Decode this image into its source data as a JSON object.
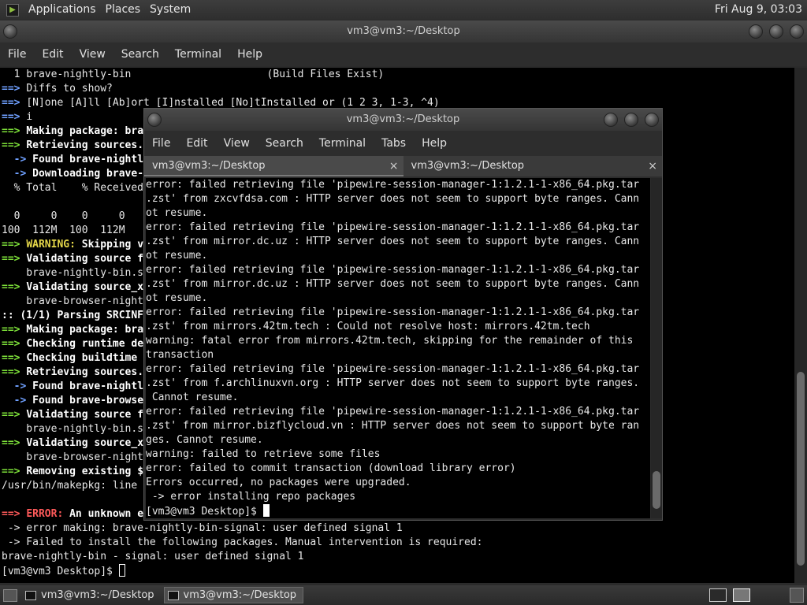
{
  "top_panel": {
    "menus": [
      "Applications",
      "Places",
      "System"
    ],
    "clock": "Fri Aug  9, 03:03"
  },
  "back_window": {
    "title": "vm3@vm3:~/Desktop",
    "menus": [
      "File",
      "Edit",
      "View",
      "Search",
      "Terminal",
      "Help"
    ],
    "lines": [
      [
        {
          "t": "  1 brave-nightly-bin                      (Build Files Exist)"
        }
      ],
      [
        {
          "t": "==> ",
          "c": "blue"
        },
        {
          "t": "Diffs to show?"
        }
      ],
      [
        {
          "t": "==> ",
          "c": "blue"
        },
        {
          "t": "[N]one [A]ll [Ab]ort [I]nstalled [No]tInstalled or (1 2 3, 1-3, ^4)"
        }
      ],
      [
        {
          "t": "==> ",
          "c": "blue"
        },
        {
          "t": "i"
        }
      ],
      [
        {
          "t": "==> ",
          "c": "green"
        },
        {
          "t": "Making package: bra",
          "c": "white"
        }
      ],
      [
        {
          "t": "==> ",
          "c": "green"
        },
        {
          "t": "Retrieving sources.",
          "c": "white"
        }
      ],
      [
        {
          "t": "  -> ",
          "c": "blue"
        },
        {
          "t": "Found brave-nightl",
          "c": "white"
        }
      ],
      [
        {
          "t": "  -> ",
          "c": "blue"
        },
        {
          "t": "Downloading brave-",
          "c": "white"
        }
      ],
      [
        {
          "t": "  % Total    % Received"
        }
      ],
      [
        {
          "t": ""
        }
      ],
      [
        {
          "t": "  0     0    0     0"
        }
      ],
      [
        {
          "t": "100  112M  100  112M"
        }
      ],
      [
        {
          "t": "==> ",
          "c": "green"
        },
        {
          "t": "WARNING: ",
          "c": "yellow"
        },
        {
          "t": "Skipping v",
          "c": "white"
        }
      ],
      [
        {
          "t": "==> ",
          "c": "green"
        },
        {
          "t": "Validating source f",
          "c": "white"
        }
      ],
      [
        {
          "t": "    brave-nightly-bin.s"
        }
      ],
      [
        {
          "t": "==> ",
          "c": "green"
        },
        {
          "t": "Validating source_x",
          "c": "white"
        }
      ],
      [
        {
          "t": "    brave-browser-night"
        }
      ],
      [
        {
          "t": ":: (1/1) Parsing SRCINF",
          "c": "white"
        }
      ],
      [
        {
          "t": "==> ",
          "c": "green"
        },
        {
          "t": "Making package: bra",
          "c": "white"
        }
      ],
      [
        {
          "t": "==> ",
          "c": "green"
        },
        {
          "t": "Checking runtime de",
          "c": "white"
        }
      ],
      [
        {
          "t": "==> ",
          "c": "green"
        },
        {
          "t": "Checking buildtime ",
          "c": "white"
        }
      ],
      [
        {
          "t": "==> ",
          "c": "green"
        },
        {
          "t": "Retrieving sources.",
          "c": "white"
        }
      ],
      [
        {
          "t": "  -> ",
          "c": "blue"
        },
        {
          "t": "Found brave-nightl",
          "c": "white"
        }
      ],
      [
        {
          "t": "  -> ",
          "c": "blue"
        },
        {
          "t": "Found brave-browse",
          "c": "white"
        }
      ],
      [
        {
          "t": "==> ",
          "c": "green"
        },
        {
          "t": "Validating source f",
          "c": "white"
        }
      ],
      [
        {
          "t": "    brave-nightly-bin.s"
        }
      ],
      [
        {
          "t": "==> ",
          "c": "green"
        },
        {
          "t": "Validating source_x",
          "c": "white"
        }
      ],
      [
        {
          "t": "    brave-browser-night"
        }
      ],
      [
        {
          "t": "==> ",
          "c": "green"
        },
        {
          "t": "Removing existing $",
          "c": "white"
        }
      ],
      [
        {
          "t": "/usr/bin/makepkg: line "
        }
      ],
      [
        {
          "t": ""
        }
      ],
      [
        {
          "t": "==> ",
          "c": "red"
        },
        {
          "t": "ERROR: ",
          "c": "red"
        },
        {
          "t": "An unknown e",
          "c": "white"
        }
      ],
      [
        {
          "t": " -> error making: brave-nightly-bin-signal: user defined signal 1"
        }
      ],
      [
        {
          "t": " -> Failed to install the following packages. Manual intervention is required:"
        }
      ],
      [
        {
          "t": "brave-nightly-bin - signal: user defined signal 1"
        }
      ],
      [
        {
          "t": "[vm3@vm3 Desktop]$ "
        },
        {
          "cursor": true
        }
      ]
    ]
  },
  "front_window": {
    "title": "vm3@vm3:~/Desktop",
    "menus": [
      "File",
      "Edit",
      "View",
      "Search",
      "Terminal",
      "Tabs",
      "Help"
    ],
    "tabs": [
      "vm3@vm3:~/Desktop",
      "vm3@vm3:~/Desktop"
    ],
    "tab_close": "×",
    "lines": [
      "error: failed retrieving file 'pipewire-session-manager-1:1.2.1-1-x86_64.pkg.tar",
      ".zst' from zxcvfdsa.com : HTTP server does not seem to support byte ranges. Cann",
      "ot resume.",
      "error: failed retrieving file 'pipewire-session-manager-1:1.2.1-1-x86_64.pkg.tar",
      ".zst' from mirror.dc.uz : HTTP server does not seem to support byte ranges. Cann",
      "ot resume.",
      "error: failed retrieving file 'pipewire-session-manager-1:1.2.1-1-x86_64.pkg.tar",
      ".zst' from mirror.dc.uz : HTTP server does not seem to support byte ranges. Cann",
      "ot resume.",
      "error: failed retrieving file 'pipewire-session-manager-1:1.2.1-1-x86_64.pkg.tar",
      ".zst' from mirrors.42tm.tech : Could not resolve host: mirrors.42tm.tech",
      "warning: fatal error from mirrors.42tm.tech, skipping for the remainder of this",
      "transaction",
      "error: failed retrieving file 'pipewire-session-manager-1:1.2.1-1-x86_64.pkg.tar",
      ".zst' from f.archlinuxvn.org : HTTP server does not seem to support byte ranges.",
      " Cannot resume.",
      "error: failed retrieving file 'pipewire-session-manager-1:1.2.1-1-x86_64.pkg.tar",
      ".zst' from mirror.bizflycloud.vn : HTTP server does not seem to support byte ran",
      "ges. Cannot resume.",
      "warning: failed to retrieve some files",
      "error: failed to commit transaction (download library error)",
      "Errors occurred, no packages were upgraded.",
      " -> error installing repo packages",
      "[vm3@vm3 Desktop]$ "
    ]
  },
  "taskbar": {
    "tasks": [
      "vm3@vm3:~/Desktop",
      "vm3@vm3:~/Desktop"
    ]
  }
}
